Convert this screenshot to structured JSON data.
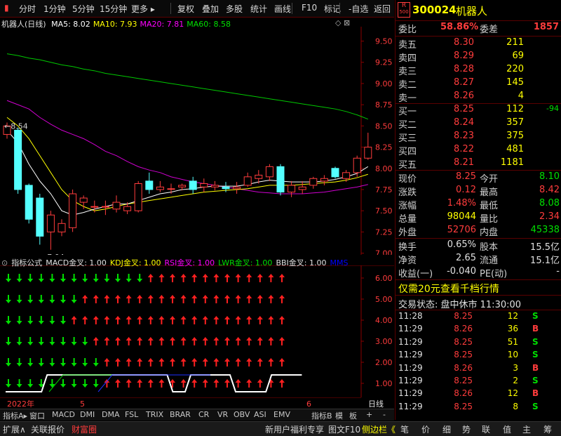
{
  "toolbar": {
    "items": [
      "分时",
      "1分钟",
      "5分钟",
      "15分钟",
      "更多",
      "复权",
      "叠加",
      "多股",
      "统计",
      "画线",
      "F10",
      "标记",
      "-自选",
      "返回"
    ]
  },
  "chart": {
    "title": "机器人(日线)",
    "ma": [
      {
        "label": "MA5: 8.02",
        "color": "#ffffff"
      },
      {
        "label": "MA10: 7.93",
        "color": "#ffff00"
      },
      {
        "label": "MA20: 7.81",
        "color": "#ff00ff"
      },
      {
        "label": "MA60: 8.58",
        "color": "#00e000"
      }
    ],
    "high_label": "8.54",
    "low_label": "7.04",
    "cai_label": "财"
  },
  "chart_data": {
    "type": "candlestick",
    "y_ticks": [
      9.5,
      9.25,
      9.0,
      8.75,
      8.5,
      8.25,
      8.0,
      7.75,
      7.5,
      7.25,
      7.0
    ],
    "ylim": [
      6.98,
      9.67
    ],
    "candles": [
      {
        "o": 8.4,
        "h": 8.54,
        "l": 8.35,
        "c": 8.5
      },
      {
        "o": 8.45,
        "h": 8.48,
        "l": 7.7,
        "c": 7.75
      },
      {
        "o": 7.8,
        "h": 7.82,
        "l": 7.35,
        "c": 7.4
      },
      {
        "o": 7.65,
        "h": 7.7,
        "l": 7.1,
        "c": 7.2
      },
      {
        "o": 7.25,
        "h": 7.5,
        "l": 7.04,
        "c": 7.45
      },
      {
        "o": 7.25,
        "h": 7.4,
        "l": 7.2,
        "c": 7.35
      },
      {
        "o": 7.3,
        "h": 7.75,
        "l": 7.25,
        "c": 7.7
      },
      {
        "o": 7.6,
        "h": 7.68,
        "l": 7.52,
        "c": 7.65
      },
      {
        "o": 7.55,
        "h": 7.62,
        "l": 7.48,
        "c": 7.55
      },
      {
        "o": 7.55,
        "h": 7.62,
        "l": 7.45,
        "c": 7.55
      },
      {
        "o": 7.52,
        "h": 7.68,
        "l": 7.48,
        "c": 7.6
      },
      {
        "o": 7.5,
        "h": 7.6,
        "l": 7.46,
        "c": 7.55
      },
      {
        "o": 7.5,
        "h": 7.85,
        "l": 7.48,
        "c": 7.82
      },
      {
        "o": 7.85,
        "h": 7.95,
        "l": 7.7,
        "c": 7.75
      },
      {
        "o": 7.75,
        "h": 7.85,
        "l": 7.72,
        "c": 7.78
      },
      {
        "o": 7.76,
        "h": 7.82,
        "l": 7.7,
        "c": 7.76
      },
      {
        "o": 7.78,
        "h": 7.82,
        "l": 7.74,
        "c": 7.8
      },
      {
        "o": 7.85,
        "h": 7.9,
        "l": 7.7,
        "c": 7.75
      },
      {
        "o": 7.78,
        "h": 7.88,
        "l": 7.72,
        "c": 7.82
      },
      {
        "o": 7.78,
        "h": 7.85,
        "l": 7.74,
        "c": 7.8
      },
      {
        "o": 7.78,
        "h": 7.84,
        "l": 7.72,
        "c": 7.76
      },
      {
        "o": 7.76,
        "h": 7.84,
        "l": 7.7,
        "c": 7.78
      },
      {
        "o": 7.8,
        "h": 7.95,
        "l": 7.78,
        "c": 7.9
      },
      {
        "o": 7.88,
        "h": 7.98,
        "l": 7.82,
        "c": 7.92
      },
      {
        "o": 7.9,
        "h": 8.05,
        "l": 7.85,
        "c": 8.02
      },
      {
        "o": 8.02,
        "h": 8.05,
        "l": 7.68,
        "c": 7.72
      },
      {
        "o": 7.72,
        "h": 7.85,
        "l": 7.66,
        "c": 7.8
      },
      {
        "o": 7.75,
        "h": 7.85,
        "l": 7.7,
        "c": 7.78
      },
      {
        "o": 7.8,
        "h": 7.9,
        "l": 7.76,
        "c": 7.88
      },
      {
        "o": 7.85,
        "h": 7.92,
        "l": 7.8,
        "c": 7.88
      },
      {
        "o": 8.0,
        "h": 8.02,
        "l": 7.88,
        "c": 7.9
      },
      {
        "o": 7.88,
        "h": 7.98,
        "l": 7.84,
        "c": 7.95
      },
      {
        "o": 7.95,
        "h": 8.15,
        "l": 7.9,
        "c": 8.12
      },
      {
        "o": 8.12,
        "h": 8.42,
        "l": 8.1,
        "c": 8.25
      }
    ],
    "ma5": [
      8.45,
      8.3,
      8.05,
      7.85,
      7.7,
      7.5,
      7.45,
      7.48,
      7.52,
      7.55,
      7.58,
      7.58,
      7.62,
      7.66,
      7.7,
      7.72,
      7.75,
      7.76,
      7.78,
      7.79,
      7.79,
      7.79,
      7.81,
      7.84,
      7.86,
      7.85,
      7.84,
      7.84,
      7.84,
      7.85,
      7.87,
      7.9,
      7.94,
      8.02
    ],
    "ma10": [
      8.6,
      8.5,
      8.35,
      8.15,
      7.95,
      7.75,
      7.62,
      7.55,
      7.5,
      7.52,
      7.55,
      7.58,
      7.6,
      7.62,
      7.64,
      7.66,
      7.68,
      7.7,
      7.72,
      7.73,
      7.74,
      7.75,
      7.76,
      7.78,
      7.8,
      7.8,
      7.8,
      7.81,
      7.82,
      7.83,
      7.84,
      7.86,
      7.89,
      7.93
    ],
    "ma20": [
      8.8,
      8.75,
      8.7,
      8.6,
      8.52,
      8.45,
      8.4,
      8.35,
      8.28,
      8.2,
      8.15,
      8.08,
      8.02,
      7.98,
      7.95,
      7.9,
      7.87,
      7.84,
      7.82,
      7.8,
      7.78,
      7.76,
      7.74,
      7.72,
      7.71,
      7.7,
      7.7,
      7.7,
      7.71,
      7.72,
      7.74,
      7.76,
      7.78,
      7.81
    ],
    "ma60": [
      9.35,
      9.33,
      9.3,
      9.28,
      9.25,
      9.22,
      9.2,
      9.17,
      9.15,
      9.12,
      9.1,
      9.08,
      9.06,
      9.04,
      9.02,
      9.0,
      8.98,
      8.96,
      8.94,
      8.92,
      8.9,
      8.88,
      8.86,
      8.84,
      8.82,
      8.8,
      8.78,
      8.76,
      8.74,
      8.72,
      8.7,
      8.67,
      8.63,
      8.58
    ],
    "x_ticks": [
      {
        "label": "2022年",
        "index": 0
      },
      {
        "label": "5",
        "index": 8
      },
      {
        "label": "6",
        "index": 33
      }
    ],
    "indicator": {
      "y_ticks": [
        "6.00",
        "5.00",
        "4.00",
        "3.00",
        "2.00",
        "1.00"
      ],
      "rows_up_from": [
        13,
        7,
        6,
        8,
        9,
        9
      ],
      "rows_down_last": [
        12,
        6,
        5,
        7,
        8,
        8
      ],
      "step_line": [
        0,
        0,
        0,
        0,
        0,
        1,
        1,
        1,
        1,
        1,
        1,
        1,
        1,
        1,
        1,
        1,
        1,
        1,
        1,
        0,
        0,
        1,
        1,
        1,
        1,
        1,
        0,
        0,
        0,
        0,
        1,
        1,
        1,
        1
      ]
    }
  },
  "indicator": {
    "header": [
      {
        "label": "指标公式",
        "color": "#e0e0e0"
      },
      {
        "label": "MACD金叉: 1.00",
        "color": "#e0e0e0"
      },
      {
        "label": "KDJ金叉: 1.00",
        "color": "#ffff00"
      },
      {
        "label": "RSI金叉: 1.00",
        "color": "#ff00ff"
      },
      {
        "label": "LWR金叉: 1.00",
        "color": "#00e000"
      },
      {
        "label": "BBI金叉: 1.00",
        "color": "#e0e0e0"
      },
      {
        "label": "MMS",
        "color": "#0000ff"
      }
    ]
  },
  "tabs": {
    "left": [
      "指标A",
      "窗口",
      "MACD",
      "DMI",
      "DMA",
      "FSL",
      "TRIX",
      "BRAR",
      "CR",
      "VR",
      "OBV",
      "ASI",
      "EMV"
    ],
    "right": [
      "指标B",
      "模",
      "板",
      "+",
      "-"
    ],
    "cycle": "日线"
  },
  "status": {
    "left": [
      "扩展∧",
      "关联报价",
      "财富圈"
    ],
    "mid": [
      "新用户福利专享",
      "图文F10",
      "侧边栏《"
    ],
    "right": [
      "笔",
      "价",
      "细",
      "势",
      "联",
      "值",
      "主",
      "筹"
    ]
  },
  "quote": {
    "code": "300024",
    "name": "机器人",
    "badge_top": "R",
    "badge_bot": "500",
    "weibi_label": "委比",
    "weibi_val": "58.86%",
    "weicha_label": "委差",
    "weicha_val": "1857",
    "asks": [
      {
        "l": "卖五",
        "p": "8.30",
        "v": "211"
      },
      {
        "l": "卖四",
        "p": "8.29",
        "v": "69"
      },
      {
        "l": "卖三",
        "p": "8.28",
        "v": "220"
      },
      {
        "l": "卖二",
        "p": "8.27",
        "v": "145"
      },
      {
        "l": "卖一",
        "p": "8.26",
        "v": "4"
      }
    ],
    "bids": [
      {
        "l": "买一",
        "p": "8.25",
        "v": "112",
        "d": "-94"
      },
      {
        "l": "买二",
        "p": "8.24",
        "v": "357",
        "d": ""
      },
      {
        "l": "买三",
        "p": "8.23",
        "v": "375",
        "d": ""
      },
      {
        "l": "买四",
        "p": "8.22",
        "v": "481",
        "d": ""
      },
      {
        "l": "买五",
        "p": "8.21",
        "v": "1181",
        "d": ""
      }
    ],
    "stats": [
      {
        "a": "现价",
        "b": "8.25",
        "bc": "#ff3c3c",
        "c": "今开",
        "e": "8.10",
        "ec": "#00e000"
      },
      {
        "a": "涨跌",
        "b": "0.12",
        "bc": "#ff3c3c",
        "c": "最高",
        "e": "8.42",
        "ec": "#ff3c3c"
      },
      {
        "a": "涨幅",
        "b": "1.48%",
        "bc": "#ff3c3c",
        "c": "最低",
        "e": "8.08",
        "ec": "#00e000"
      },
      {
        "a": "总量",
        "b": "98044",
        "bc": "#ffff00",
        "c": "量比",
        "e": "2.34",
        "ec": "#ff3c3c"
      },
      {
        "a": "外盘",
        "b": "52706",
        "bc": "#ff3c3c",
        "c": "内盘",
        "e": "45338",
        "ec": "#00e000"
      }
    ],
    "stats2": [
      {
        "a": "换手",
        "b": "0.65%",
        "bc": "#e0e0e0",
        "c": "股本",
        "e": "15.5亿",
        "ec": "#e0e0e0"
      },
      {
        "a": "净资",
        "b": "2.65",
        "bc": "#e0e0e0",
        "c": "流通",
        "e": "15.1亿",
        "ec": "#e0e0e0"
      },
      {
        "a": "收益(一)",
        "b": "-0.040",
        "bc": "#e0e0e0",
        "c": "PE(动)",
        "e": "-",
        "ec": "#e0e0e0"
      }
    ],
    "promo": "仅需20元查看千档行情",
    "trade_state": "交易状态: 盘中休市 11:30:00",
    "ticks": [
      {
        "t": "11:28",
        "p": "8.25",
        "v": "12",
        "f": "S",
        "fc": "#00e000"
      },
      {
        "t": "11:29",
        "p": "8.26",
        "v": "36",
        "f": "B",
        "fc": "#ff3c3c"
      },
      {
        "t": "11:29",
        "p": "8.25",
        "v": "51",
        "f": "S",
        "fc": "#00e000"
      },
      {
        "t": "11:29",
        "p": "8.25",
        "v": "10",
        "f": "S",
        "fc": "#00e000"
      },
      {
        "t": "11:29",
        "p": "8.26",
        "v": "3",
        "f": "B",
        "fc": "#ff3c3c"
      },
      {
        "t": "11:29",
        "p": "8.25",
        "v": "2",
        "f": "S",
        "fc": "#00e000"
      },
      {
        "t": "11:29",
        "p": "8.26",
        "v": "12",
        "f": "B",
        "fc": "#ff3c3c"
      },
      {
        "t": "11:29",
        "p": "8.25",
        "v": "8",
        "f": "S",
        "fc": "#00e000"
      }
    ]
  }
}
